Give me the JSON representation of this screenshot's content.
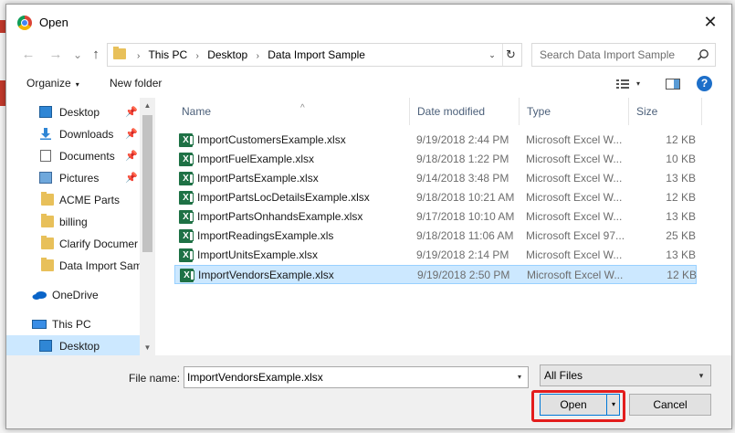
{
  "window": {
    "title": "Open",
    "close_glyph": "✕"
  },
  "nav_buttons": {
    "back_glyph": "←",
    "forward_glyph": "→",
    "recent_glyph": "⌄",
    "up_glyph": "↑"
  },
  "address": {
    "crumbs": [
      "This PC",
      "Desktop",
      "Data Import Sample"
    ],
    "separator": "›",
    "dropdown_glyph": "⌄",
    "refresh_glyph": "↻"
  },
  "search": {
    "placeholder": "Search Data Import Sample"
  },
  "toolbar": {
    "organize": "Organize",
    "new_folder": "New folder",
    "dropdown_glyph": "▾",
    "help": "?"
  },
  "sidebar": {
    "items": [
      {
        "label": "Desktop",
        "icon": "desktop-icon",
        "pinned": true
      },
      {
        "label": "Downloads",
        "icon": "downloads-icon",
        "pinned": true
      },
      {
        "label": "Documents",
        "icon": "documents-icon",
        "pinned": true
      },
      {
        "label": "Pictures",
        "icon": "pictures-icon",
        "pinned": true
      },
      {
        "label": "ACME Parts",
        "icon": "folder-icon",
        "pinned": false
      },
      {
        "label": "billing",
        "icon": "folder-icon",
        "pinned": false
      },
      {
        "label": "Clarify Documer",
        "icon": "folder-icon",
        "pinned": false
      },
      {
        "label": "Data Import Sam",
        "icon": "folder-icon",
        "pinned": false
      },
      {
        "label": "OneDrive",
        "icon": "onedrive-icon",
        "pinned": false
      },
      {
        "label": "This PC",
        "icon": "this-pc-icon",
        "pinned": false
      },
      {
        "label": "Desktop",
        "icon": "desktop-icon",
        "pinned": false,
        "selected": true
      }
    ],
    "pin_glyph": "📌",
    "scroll_up_glyph": "▲",
    "scroll_down_glyph": "▼"
  },
  "columns": {
    "name": "Name",
    "date": "Date modified",
    "type": "Type",
    "size": "Size",
    "sort_glyph": "^"
  },
  "files": [
    {
      "name": "ImportCustomersExample.xlsx",
      "date": "9/19/2018 2:44 PM",
      "type": "Microsoft Excel W...",
      "size": "12 KB"
    },
    {
      "name": "ImportFuelExample.xlsx",
      "date": "9/18/2018 1:22 PM",
      "type": "Microsoft Excel W...",
      "size": "10 KB"
    },
    {
      "name": "ImportPartsExample.xlsx",
      "date": "9/14/2018 3:48 PM",
      "type": "Microsoft Excel W...",
      "size": "13 KB"
    },
    {
      "name": "ImportPartsLocDetailsExample.xlsx",
      "date": "9/18/2018 10:21 AM",
      "type": "Microsoft Excel W...",
      "size": "12 KB"
    },
    {
      "name": "ImportPartsOnhandsExample.xlsx",
      "date": "9/17/2018 10:10 AM",
      "type": "Microsoft Excel W...",
      "size": "13 KB"
    },
    {
      "name": "ImportReadingsExample.xls",
      "date": "9/18/2018 11:06 AM",
      "type": "Microsoft Excel 97...",
      "size": "25 KB"
    },
    {
      "name": "ImportUnitsExample.xlsx",
      "date": "9/19/2018 2:14 PM",
      "type": "Microsoft Excel W...",
      "size": "13 KB"
    },
    {
      "name": "ImportVendorsExample.xlsx",
      "date": "9/19/2018 2:50 PM",
      "type": "Microsoft Excel W...",
      "size": "12 KB",
      "selected": true
    }
  ],
  "file_icon_letter": "X",
  "footer": {
    "file_name_label": "File name:",
    "file_name_value": "ImportVendorsExample.xlsx",
    "filter_value": "All Files",
    "dropdown_glyph": "▾",
    "open_label": "Open",
    "cancel_label": "Cancel"
  },
  "colors": {
    "selection": "#cce8ff",
    "highlight": "#e31d1d",
    "accent": "#0078d7",
    "excel_green": "#1e7145"
  }
}
